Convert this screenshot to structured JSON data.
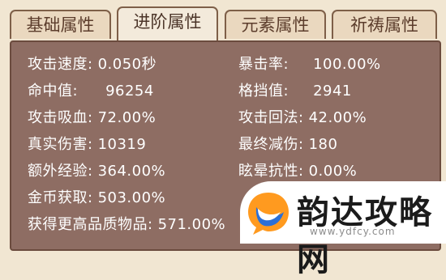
{
  "tabs": [
    {
      "label": "基础属性",
      "active": false
    },
    {
      "label": "进阶属性",
      "active": true
    },
    {
      "label": "元素属性",
      "active": false
    },
    {
      "label": "祈祷属性",
      "active": false
    }
  ],
  "stats_left": [
    {
      "label": "攻击速度:",
      "value": "0.050秒"
    },
    {
      "label": "命中值:",
      "value": "96254"
    },
    {
      "label": "攻击吸血:",
      "value": "72.00%"
    },
    {
      "label": "真实伤害:",
      "value": "10319"
    },
    {
      "label": "额外经验:",
      "value": "364.00%"
    },
    {
      "label": "金币获取:",
      "value": "503.00%"
    },
    {
      "label": "获得更高品质物品:",
      "value": "571.00%"
    }
  ],
  "stats_right": [
    {
      "label": "暴击率:",
      "value": "100.00%"
    },
    {
      "label": "格挡值:",
      "value": "2941"
    },
    {
      "label": "攻击回法:",
      "value": "42.00%"
    },
    {
      "label": "最终减伤:",
      "value": "180"
    },
    {
      "label": "眩晕抗性:",
      "value": "0.00%"
    }
  ],
  "watermark": {
    "text": "韵达攻略网",
    "url": "www.ydfcy.com",
    "icon": "chat-bubble-logo-icon"
  },
  "colors": {
    "panel": "#8e6d63",
    "tab_border": "#7e5f48",
    "text": "#ffffff"
  }
}
